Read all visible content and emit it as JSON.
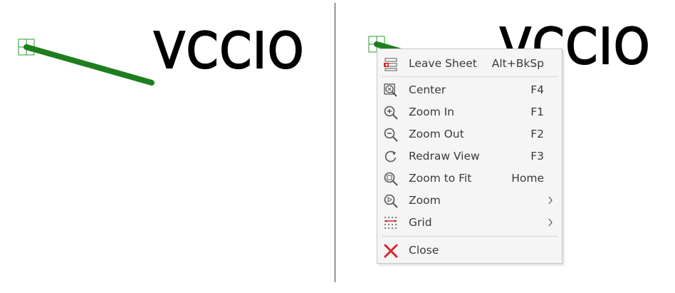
{
  "left_panel": {
    "net_label": "VCCIO"
  },
  "right_panel": {
    "net_label": "VCCIO"
  },
  "context_menu": {
    "items": [
      {
        "label": "Leave Sheet",
        "shortcut": "Alt+BkSp",
        "icon": "leave-sheet-icon"
      },
      {
        "label": "Center",
        "shortcut": "F4",
        "icon": "center-icon"
      },
      {
        "label": "Zoom In",
        "shortcut": "F1",
        "icon": "zoom-in-icon"
      },
      {
        "label": "Zoom Out",
        "shortcut": "F2",
        "icon": "zoom-out-icon"
      },
      {
        "label": "Redraw View",
        "shortcut": "F3",
        "icon": "redraw-icon"
      },
      {
        "label": "Zoom to Fit",
        "shortcut": "Home",
        "icon": "zoom-to-fit-icon"
      },
      {
        "label": "Zoom",
        "shortcut": "",
        "icon": "zoom-icon",
        "submenu": true
      },
      {
        "label": "Grid",
        "shortcut": "",
        "icon": "grid-icon",
        "submenu": true
      },
      {
        "label": "Close",
        "shortcut": "",
        "icon": "close-icon"
      }
    ]
  },
  "colors": {
    "wire": "#1e7d1e",
    "pin_box": "#2e9a2e",
    "label_text": "#000000",
    "menu_bg": "#f5f5f5",
    "menu_text": "#3a3a3a",
    "close_red": "#d9262c"
  }
}
